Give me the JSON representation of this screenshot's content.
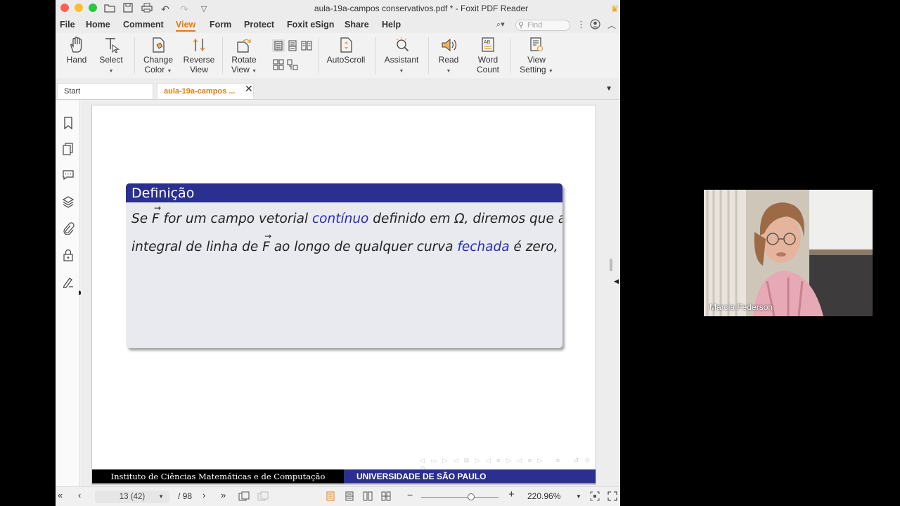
{
  "window": {
    "title": "aula-19a-campos conservativos.pdf * - Foxit PDF Reader"
  },
  "menu": {
    "items": [
      "File",
      "Home",
      "Comment",
      "View",
      "Form",
      "Protect",
      "Foxit eSign",
      "Share",
      "Help"
    ],
    "active": "View",
    "find_placeholder": "Find"
  },
  "ribbon": {
    "hand": "Hand",
    "select": "Select",
    "change_color_1": "Change",
    "change_color_2": "Color",
    "reverse_view_1": "Reverse",
    "reverse_view_2": "View",
    "rotate_view_1": "Rotate",
    "rotate_view_2": "View",
    "autoscroll": "AutoScroll",
    "assistant": "Assistant",
    "read": "Read",
    "word_count_1": "Word",
    "word_count_2": "Count",
    "view_setting_1": "View",
    "view_setting_2": "Setting"
  },
  "tabs": {
    "start": "Start",
    "doc": "aula-19a-campos ..."
  },
  "slide": {
    "block_title": "Definição",
    "line1": {
      "a": "Se ",
      "F": "F",
      "b": " for um campo vetorial ",
      "continuo": "contínuo",
      "c": " definido em Ω, diremos que a"
    },
    "line2": {
      "a": "integral de linha de ",
      "F": "F",
      "b": " ao longo de qualquer curva ",
      "fechada": "fechada",
      "c": " é zero,"
    },
    "footer_left": "Instituto de Ciências Matemáticas e de Computação",
    "footer_right": "UNIVERSIDADE DE SÃO PAULO"
  },
  "status": {
    "page_value": "13 (42)",
    "page_total": "/ 98",
    "zoom": "220.96%"
  },
  "webcam": {
    "name": "Marcia Federson"
  }
}
